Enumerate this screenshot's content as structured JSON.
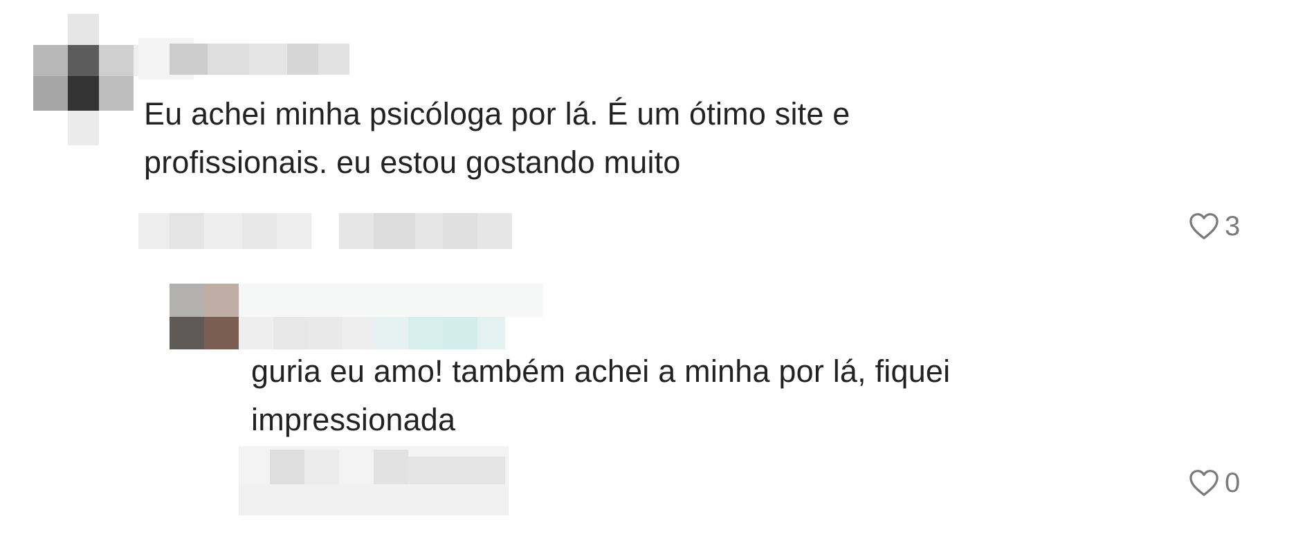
{
  "comments": [
    {
      "text_lines": [
        "Eu achei minha psicóloga por lá. É um ótimo site e",
        "profissionais. eu estou gostando muito"
      ],
      "likes": "3",
      "icon": "heart-icon"
    },
    {
      "text_lines": [
        "guria eu amo! também achei a minha por lá, fiquei",
        "impressionada"
      ],
      "likes": "0",
      "icon": "heart-icon"
    }
  ],
  "colors": {
    "text": "#222222",
    "like_count": "#7a7a7a",
    "background": "#ffffff"
  }
}
